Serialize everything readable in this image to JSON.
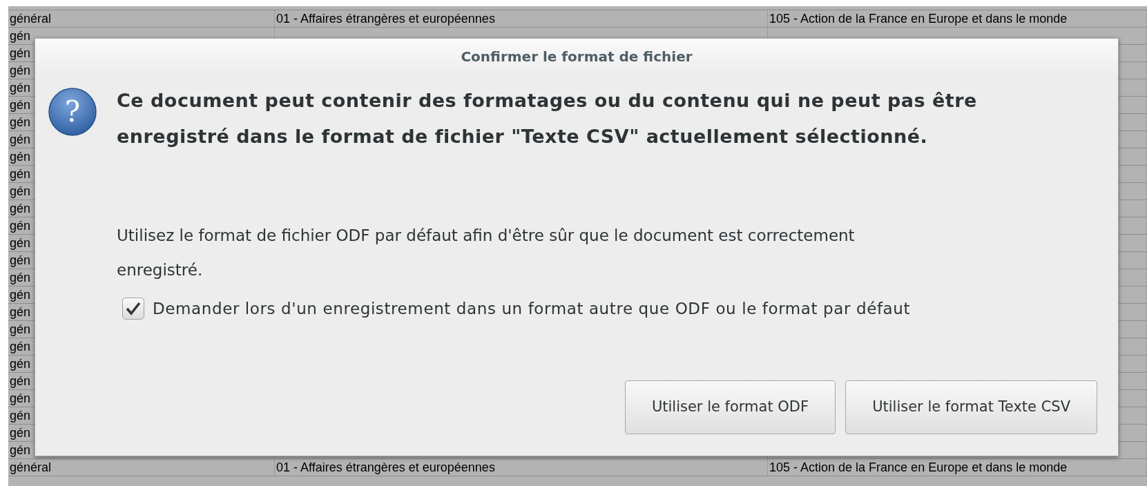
{
  "sheet": {
    "rows": [
      {
        "cells": [
          "général",
          "01 - Affaires étrangères et européennes",
          "105 - Action de la France en Europe et dans le monde"
        ]
      },
      {
        "cells": [
          "gén"
        ]
      },
      {
        "cells": [
          "gén"
        ]
      },
      {
        "cells": [
          "gén"
        ]
      },
      {
        "cells": [
          "gén"
        ]
      },
      {
        "cells": [
          "gén"
        ]
      },
      {
        "cells": [
          "gén"
        ]
      },
      {
        "cells": [
          "gén"
        ]
      },
      {
        "cells": [
          "gén"
        ]
      },
      {
        "cells": [
          "gén"
        ]
      },
      {
        "cells": [
          "gén"
        ]
      },
      {
        "cells": [
          "gén"
        ]
      },
      {
        "cells": [
          "gén"
        ]
      },
      {
        "cells": [
          "gén"
        ]
      },
      {
        "cells": [
          "gén"
        ]
      },
      {
        "cells": [
          "gén"
        ]
      },
      {
        "cells": [
          "gén"
        ]
      },
      {
        "cells": [
          "gén"
        ]
      },
      {
        "cells": [
          "gén"
        ]
      },
      {
        "cells": [
          "gén"
        ]
      },
      {
        "cells": [
          "gén"
        ]
      },
      {
        "cells": [
          "gén"
        ]
      },
      {
        "cells": [
          "gén"
        ]
      },
      {
        "cells": [
          "gén"
        ]
      },
      {
        "cells": [
          "gén"
        ]
      },
      {
        "cells": [
          "gén"
        ]
      },
      {
        "cells": [
          "général",
          "01 - Affaires étrangères et européennes",
          "105 - Action de la France en Europe et dans le monde"
        ]
      }
    ]
  },
  "dialog": {
    "title": "Confirmer le format de fichier",
    "icon_glyph": "?",
    "heading": "Ce document peut contenir des formatages ou du contenu qui ne peut pas être enregistré dans le format de fichier \"Texte CSV\" actuellement sélectionné.",
    "message": "Utilisez le format de fichier ODF par défaut afin d'être sûr que le document est correctement enregistré.",
    "checkbox": {
      "label": "Demander lors d'un enregistrement dans un format autre que ODF ou le format par défaut",
      "checked": true
    },
    "buttons": [
      "Utiliser le format ODF",
      "Utiliser le format Texte CSV"
    ]
  }
}
